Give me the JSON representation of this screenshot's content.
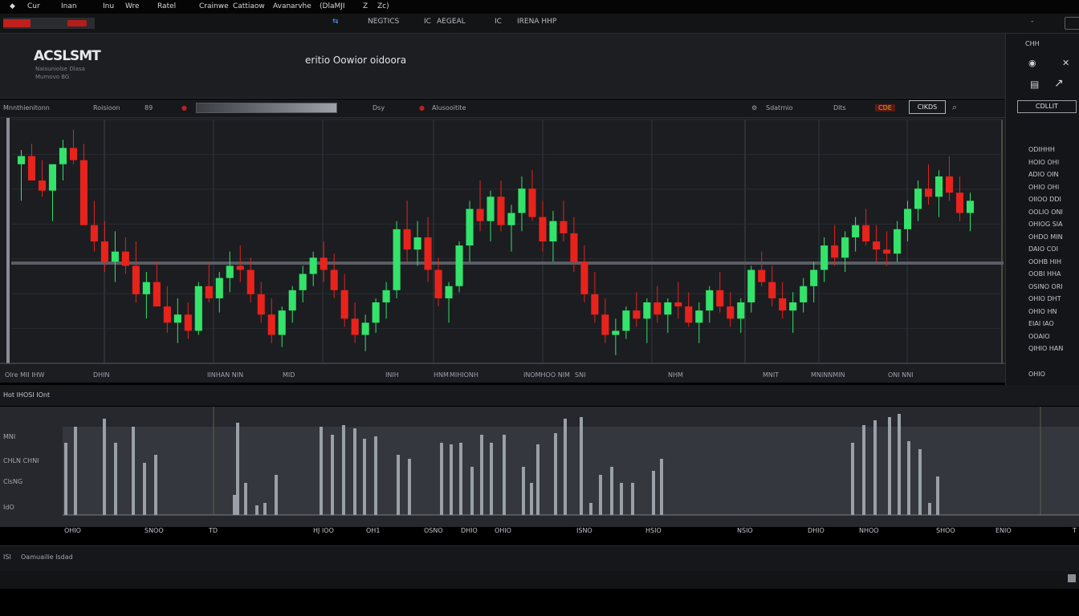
{
  "menubar": {
    "items": [
      "Cur",
      "Inan",
      "Inu",
      "Wre",
      "Ratel",
      "Crainwe",
      "Cattiaow",
      "Avan",
      "arvhe",
      "(DlaMJI",
      "Z",
      "Zc)"
    ]
  },
  "toolbar": {
    "items": [
      "NEGTICS",
      "IC",
      "AEGEAL",
      "IC",
      "IRENA HHP"
    ],
    "window_controls": [
      "-",
      ""
    ]
  },
  "header": {
    "logo": "ACSLSMT",
    "logo_sub1": "Naisuniolse Dlasa",
    "logo_sub2": "Mumovo BG",
    "title": "eritio Oowior oidoora"
  },
  "chart_toolbar": {
    "left_label": "Mnnthienitonn",
    "mode_label": "Roisioon",
    "zoom_label": "89",
    "mid_label": "Dsy",
    "mid_label2": "Alusooitite",
    "right_label": "Sdatrnio",
    "right_label2": "Dlts",
    "pair_button": "CIKDS",
    "badge": "CDE"
  },
  "x_axis_labels": [
    "Olre MII IHW",
    "DHIN",
    "IINHAN NIN",
    "MID",
    "INIH",
    "HNM",
    "MIHIONH",
    "INOMHOO NIM",
    "SNI",
    "NHM",
    "MNIT",
    "MNINNMIN",
    "ONI NNI"
  ],
  "volume": {
    "header": "Hot IHOSI IOnt",
    "y_labels": [
      "MNI",
      "CHLN CHNI",
      "ClsNG",
      "IdO"
    ],
    "x_labels": [
      "OHIO",
      "SNOO",
      "TD",
      "HJ IOO",
      "OH1",
      "OSNO",
      "DHIO",
      "OHIO",
      "ISNO",
      "HSIO",
      "NSIO",
      "DHIO",
      "NHOO",
      "SHOO",
      "ENIO",
      "T"
    ]
  },
  "bottom": {
    "label": "ISI",
    "text": "Oamuailie Isdad"
  },
  "right_panel": {
    "header": "CHH",
    "badge": "CDLLIT",
    "rows": [
      "ODIHHH",
      "HOIO OHI",
      "ADIO OIN",
      "OHIO OHI",
      "OIIOO DDI",
      "OOLIO ONI",
      "OHIOG SIA",
      "OHDO MIN",
      "DAIO COI",
      "OOHB HIH",
      "OOBI HHA",
      "OSINO ORI",
      "OHIO DHT",
      "OHIO HN",
      "EIAI IAO",
      "OOAIO",
      "QIHIO HAN"
    ],
    "footer": "OHIO"
  },
  "colors": {
    "bull": "#33e36a",
    "bear": "#e8231c",
    "grid": "#3a3d43",
    "panel": "#1b1d21"
  },
  "chart_data": {
    "type": "candlestick",
    "candles": [
      [
        88,
        95,
        70,
        92
      ],
      [
        92,
        98,
        85,
        80
      ],
      [
        80,
        90,
        72,
        75
      ],
      [
        75,
        85,
        60,
        88
      ],
      [
        88,
        100,
        80,
        96
      ],
      [
        96,
        105,
        88,
        90
      ],
      [
        90,
        98,
        70,
        58
      ],
      [
        58,
        70,
        45,
        50
      ],
      [
        50,
        60,
        35,
        40
      ],
      [
        40,
        55,
        30,
        45
      ],
      [
        45,
        52,
        34,
        38
      ],
      [
        38,
        50,
        20,
        24
      ],
      [
        24,
        35,
        12,
        30
      ],
      [
        30,
        40,
        20,
        18
      ],
      [
        18,
        28,
        5,
        10
      ],
      [
        10,
        22,
        0,
        14
      ],
      [
        14,
        20,
        2,
        6
      ],
      [
        6,
        30,
        4,
        28
      ],
      [
        28,
        40,
        20,
        22
      ],
      [
        22,
        35,
        15,
        32
      ],
      [
        32,
        45,
        25,
        38
      ],
      [
        38,
        48,
        30,
        36
      ],
      [
        36,
        42,
        20,
        24
      ],
      [
        24,
        30,
        10,
        14
      ],
      [
        14,
        22,
        0,
        4
      ],
      [
        4,
        18,
        -2,
        16
      ],
      [
        16,
        28,
        10,
        26
      ],
      [
        26,
        38,
        20,
        34
      ],
      [
        34,
        45,
        28,
        42
      ],
      [
        42,
        50,
        30,
        36
      ],
      [
        36,
        44,
        22,
        26
      ],
      [
        26,
        34,
        8,
        12
      ],
      [
        12,
        20,
        0,
        4
      ],
      [
        4,
        14,
        -4,
        10
      ],
      [
        10,
        22,
        5,
        20
      ],
      [
        20,
        30,
        12,
        26
      ],
      [
        26,
        60,
        22,
        56
      ],
      [
        56,
        70,
        40,
        46
      ],
      [
        46,
        60,
        38,
        52
      ],
      [
        52,
        62,
        30,
        36
      ],
      [
        36,
        42,
        18,
        22
      ],
      [
        22,
        30,
        10,
        28
      ],
      [
        28,
        50,
        25,
        48
      ],
      [
        48,
        70,
        40,
        66
      ],
      [
        66,
        80,
        55,
        60
      ],
      [
        60,
        75,
        50,
        72
      ],
      [
        72,
        80,
        55,
        58
      ],
      [
        58,
        68,
        45,
        64
      ],
      [
        64,
        82,
        55,
        76
      ],
      [
        76,
        85,
        60,
        62
      ],
      [
        62,
        70,
        45,
        50
      ],
      [
        50,
        65,
        40,
        60
      ],
      [
        60,
        70,
        50,
        54
      ],
      [
        54,
        62,
        35,
        40
      ],
      [
        40,
        48,
        20,
        24
      ],
      [
        24,
        35,
        10,
        14
      ],
      [
        14,
        22,
        0,
        4
      ],
      [
        4,
        12,
        -6,
        6
      ],
      [
        6,
        18,
        2,
        16
      ],
      [
        16,
        25,
        8,
        12
      ],
      [
        12,
        22,
        0,
        20
      ],
      [
        20,
        28,
        10,
        14
      ],
      [
        14,
        22,
        5,
        20
      ],
      [
        20,
        30,
        12,
        18
      ],
      [
        18,
        25,
        8,
        10
      ],
      [
        10,
        20,
        0,
        16
      ],
      [
        16,
        28,
        10,
        26
      ],
      [
        26,
        35,
        15,
        18
      ],
      [
        18,
        25,
        8,
        12
      ],
      [
        12,
        22,
        5,
        20
      ],
      [
        20,
        38,
        15,
        36
      ],
      [
        36,
        45,
        28,
        30
      ],
      [
        30,
        38,
        18,
        22
      ],
      [
        22,
        30,
        12,
        16
      ],
      [
        16,
        25,
        5,
        20
      ],
      [
        20,
        32,
        15,
        28
      ],
      [
        28,
        40,
        20,
        36
      ],
      [
        36,
        52,
        30,
        48
      ],
      [
        48,
        58,
        38,
        42
      ],
      [
        42,
        55,
        35,
        52
      ],
      [
        52,
        62,
        45,
        58
      ],
      [
        58,
        66,
        48,
        50
      ],
      [
        50,
        58,
        40,
        46
      ],
      [
        46,
        55,
        38,
        44
      ],
      [
        44,
        60,
        40,
        56
      ],
      [
        56,
        70,
        50,
        66
      ],
      [
        66,
        80,
        60,
        76
      ],
      [
        76,
        88,
        68,
        72
      ],
      [
        72,
        85,
        62,
        82
      ],
      [
        82,
        92,
        70,
        74
      ],
      [
        74,
        82,
        60,
        64
      ],
      [
        64,
        74,
        55,
        70
      ]
    ]
  }
}
